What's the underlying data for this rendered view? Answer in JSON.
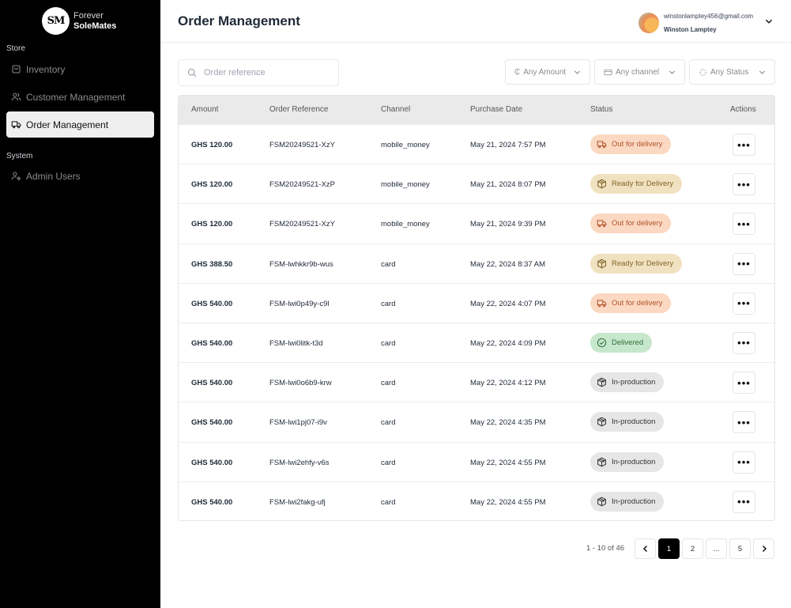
{
  "brand": {
    "logo_text": "SM",
    "line1": "Forever",
    "line2": "SoleMates"
  },
  "sidebar": {
    "sections": [
      {
        "label": "Store"
      },
      {
        "label": "System"
      }
    ],
    "items": [
      {
        "label": "Inventory",
        "icon": "bag-icon"
      },
      {
        "label": "Customer Management",
        "icon": "users-icon"
      },
      {
        "label": "Order Management",
        "icon": "truck-icon",
        "active": true
      },
      {
        "label": "Admin Users",
        "icon": "user-gear-icon"
      }
    ]
  },
  "header": {
    "title": "Order Management",
    "user_email": "winstonlamptey456@gmail.com",
    "user_name": "Winston Lamptey"
  },
  "filters": {
    "search_placeholder": "Order reference",
    "amount_symbol": "₵",
    "amount": "Any Amount",
    "channel": "Any channel",
    "status": "Any Status"
  },
  "table": {
    "columns": [
      "Amount",
      "Order Reference",
      "Channel",
      "Purchase Date",
      "Status",
      "Actions"
    ],
    "rows": [
      {
        "amount": "GHS 120.00",
        "ref": "FSM20249521-XzY",
        "channel": "mobile_money",
        "date": "May 21, 2024 7:57 PM",
        "status": "Out for delivery",
        "kind": "out"
      },
      {
        "amount": "GHS 120.00",
        "ref": "FSM20249521-XzP",
        "channel": "mobile_money",
        "date": "May 21, 2024 8:07 PM",
        "status": "Ready for Delivery",
        "kind": "ready"
      },
      {
        "amount": "GHS 120.00",
        "ref": "FSM20249521-XzY",
        "channel": "mobile_money",
        "date": "May 21, 2024 9:39 PM",
        "status": "Out for delivery",
        "kind": "out"
      },
      {
        "amount": "GHS 388.50",
        "ref": "FSM-lwhkkr9b-wus",
        "channel": "card",
        "date": "May 22, 2024 8:37 AM",
        "status": "Ready for Delivery",
        "kind": "ready"
      },
      {
        "amount": "GHS 540.00",
        "ref": "FSM-lwi0p49y-c9l",
        "channel": "card",
        "date": "May 22, 2024 4:07 PM",
        "status": "Out for delivery",
        "kind": "out"
      },
      {
        "amount": "GHS 540.00",
        "ref": "FSM-lwi0litk-t3d",
        "channel": "card",
        "date": "May 22, 2024 4:09 PM",
        "status": "Delivered",
        "kind": "delivered"
      },
      {
        "amount": "GHS 540.00",
        "ref": "FSM-lwi0o6b9-krw",
        "channel": "card",
        "date": "May 22, 2024 4:12 PM",
        "status": "In-production",
        "kind": "prod"
      },
      {
        "amount": "GHS 540.00",
        "ref": "FSM-lwi1pj07-i9v",
        "channel": "card",
        "date": "May 22, 2024 4:35 PM",
        "status": "In-production",
        "kind": "prod"
      },
      {
        "amount": "GHS 540.00",
        "ref": "FSM-lwi2ehfy-v6s",
        "channel": "card",
        "date": "May 22, 2024 4:55 PM",
        "status": "In-production",
        "kind": "prod"
      },
      {
        "amount": "GHS 540.00",
        "ref": "FSM-lwi2fakg-ufj",
        "channel": "card",
        "date": "May 22, 2024 4:55 PM",
        "status": "In-production",
        "kind": "prod"
      }
    ],
    "action_label": "•••"
  },
  "pagination": {
    "range": "1 - 10 of 46",
    "pages": [
      "1",
      "2",
      "...",
      "5"
    ],
    "current": "1"
  },
  "colors": {
    "sidebar_bg": "#000000",
    "active_page": "#000000",
    "out": "#fbd8c2",
    "ready": "#f0e2c0",
    "delivered": "#c6e7cb",
    "prod": "#e6e6e6"
  }
}
